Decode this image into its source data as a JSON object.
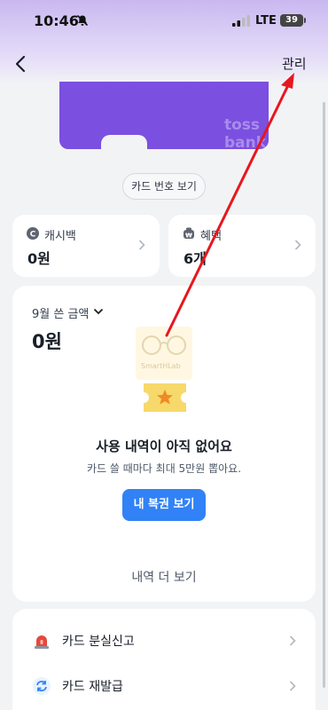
{
  "status_bar": {
    "time": "10:46",
    "network": "LTE",
    "battery": "39"
  },
  "header": {
    "manage_label": "관리"
  },
  "card": {
    "brand_text": "toss bank"
  },
  "card_number_button": "카드 번호 보기",
  "tiles": {
    "cashback": {
      "label": "캐시백",
      "value": "0원"
    },
    "benefit": {
      "label": "혜택",
      "value": "6개"
    }
  },
  "spending": {
    "month_label": "9월 쓴 금액",
    "amount": "0원",
    "watermark": "SmartHLab",
    "empty_title": "사용 내역이 아직 없어요",
    "empty_subtitle": "카드 쓸 때마다 최대 5만원 뽑아요.",
    "lottery_button": "내 복권 보기",
    "more_history": "내역 더 보기"
  },
  "menu": [
    {
      "label": "카드 분실신고",
      "icon": "siren-icon"
    },
    {
      "label": "카드 재발급",
      "icon": "reissue-icon"
    }
  ],
  "colors": {
    "card_purple": "#7b4fe0",
    "primary_blue": "#3182f6",
    "annotation_red": "#e8161f"
  }
}
